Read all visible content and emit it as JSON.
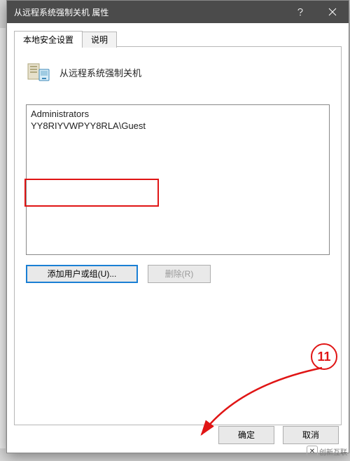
{
  "window": {
    "title": "从远程系统强制关机 属性"
  },
  "tabs": {
    "active": "本地安全设置",
    "inactive": "说明"
  },
  "policy": {
    "name": "从远程系统强制关机"
  },
  "list": {
    "items": [
      "Administrators",
      "YY8RIYVWPYY8RLA\\Guest"
    ]
  },
  "buttons": {
    "add": "添加用户或组(U)...",
    "remove": "删除(R)",
    "ok": "确定",
    "cancel": "取消"
  },
  "callout": {
    "label": "11"
  },
  "watermark": {
    "text": "创新互联"
  }
}
